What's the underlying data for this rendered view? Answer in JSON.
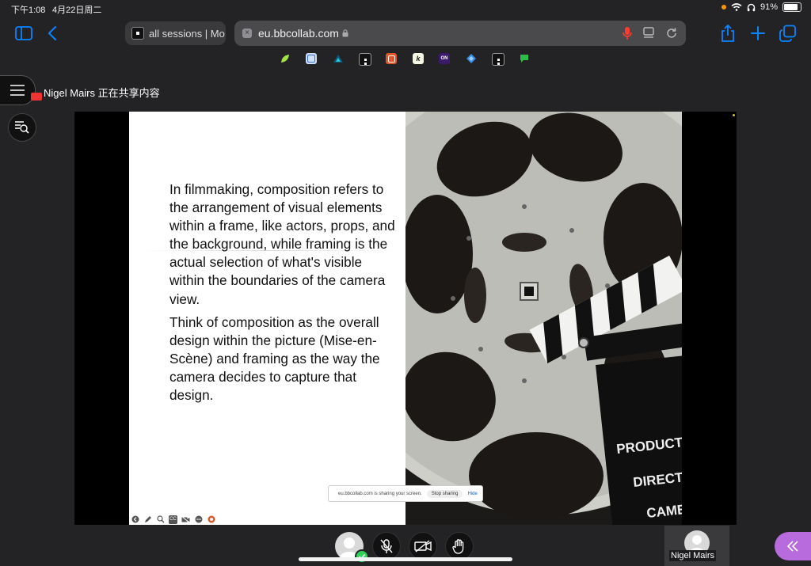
{
  "status_bar": {
    "time": "下午1:08",
    "date": "4月22日周二",
    "battery": "91%"
  },
  "browser": {
    "tab_title": "all sessions | Mo",
    "url": "eu.bbcollab.com",
    "bookmarks": [
      "leaf",
      "blue-square",
      "dark-triangle",
      "bb-logo",
      "orange-square",
      "k-logo",
      "on-logo",
      "blue-diamond",
      "bb-logo-2",
      "green-chat"
    ]
  },
  "collab": {
    "presenter_share_label": "Nigel Mairs 正在共享内容",
    "slide": {
      "paragraph1": "In filmmaking, composition refers to the arrangement of visual elements within a frame, like actors, props, and the background, while framing is the actual selection of what's visible within the boundaries of the camera view.",
      "paragraph2": "Think of composition as the overall design within the picture (Mise-en-Scène) and framing as the way the camera decides to capture that design."
    },
    "clapboard": {
      "line1": "PRODUCT",
      "line2": "DIRECT",
      "line3": "CAME"
    },
    "share_bar": {
      "message": "eu.bbcollab.com is sharing your screen.",
      "stop": "Stop sharing",
      "hide": "Hide"
    },
    "slide_tools": {
      "cc": "CC"
    },
    "participant": {
      "name": "Nigel Mairs"
    }
  },
  "colors": {
    "accent": "#0a84ff",
    "collapse": "#b86bdc",
    "presence": "#30d158"
  }
}
